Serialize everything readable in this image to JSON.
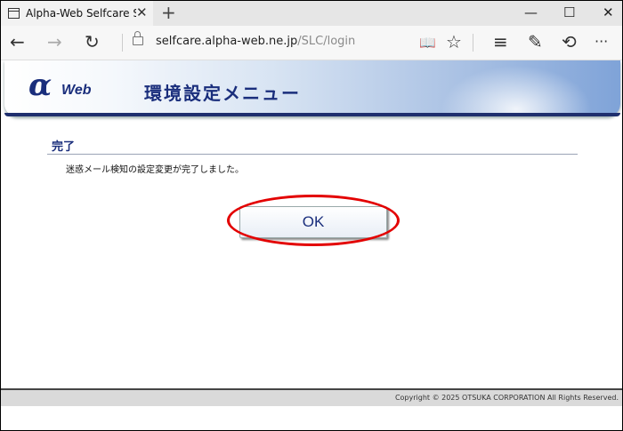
{
  "browser": {
    "tab_title": "Alpha-Web Selfcare Serv",
    "tab_close": "✕",
    "new_tab": "+",
    "window_controls": {
      "minimize": "—",
      "maximize": "☐",
      "close": "✕"
    },
    "url_domain": "selfcare.alpha-web.ne.jp",
    "url_path": "/SLC/login",
    "icons": [
      "back-arrow-icon",
      "forward-arrow-icon",
      "refresh-icon",
      "lock-icon",
      "reading-view-icon",
      "favorites-star-icon",
      "hub-icon",
      "web-note-icon",
      "share-icon",
      "more-icon"
    ],
    "icon_glyphs": {
      "back": "←",
      "forward": "→",
      "refresh": "↻",
      "reading": "📖",
      "star": "☆",
      "hub": "≡",
      "note": "✎",
      "share": "⟲",
      "more": "···"
    }
  },
  "banner": {
    "logo_alpha": "α",
    "logo_web": "Web",
    "title": "環境設定メニュー"
  },
  "content": {
    "heading": "完了",
    "message": "迷惑メール検知の設定変更が完了しました。",
    "ok_label": "OK"
  },
  "footer": {
    "copyright": "Copyright © 2025 OTSUKA CORPORATION All Rights Reserved."
  },
  "colors": {
    "brand_navy": "#1a2e7c",
    "highlight_red": "#e30000"
  }
}
